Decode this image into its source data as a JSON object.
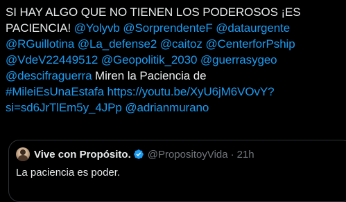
{
  "tweet": {
    "lines": [
      [
        {
          "type": "text",
          "text": "SI HAY ALGO QUE NO TIENEN LOS PODEROSOS ¡ES"
        }
      ],
      [
        {
          "type": "text",
          "text": "PACIENCIA! "
        },
        {
          "type": "mention",
          "text": "@Yolyvb"
        },
        {
          "type": "text",
          "text": " "
        },
        {
          "type": "mention",
          "text": "@SorprendenteF"
        },
        {
          "type": "text",
          "text": " "
        },
        {
          "type": "mention",
          "text": "@dataurgente"
        }
      ],
      [
        {
          "type": "mention",
          "text": "@RGuillotina"
        },
        {
          "type": "text",
          "text": " "
        },
        {
          "type": "mention",
          "text": "@La_defense2"
        },
        {
          "type": "text",
          "text": " "
        },
        {
          "type": "mention",
          "text": "@caitoz"
        },
        {
          "type": "text",
          "text": " "
        },
        {
          "type": "mention",
          "text": "@CenterforPship"
        }
      ],
      [
        {
          "type": "mention",
          "text": "@VdeV22449512"
        },
        {
          "type": "text",
          "text": " "
        },
        {
          "type": "mention",
          "text": "@Geopolitik_2030"
        },
        {
          "type": "text",
          "text": " "
        },
        {
          "type": "mention",
          "text": "@guerrasygeo"
        }
      ],
      [
        {
          "type": "mention",
          "text": "@descifraguerra"
        },
        {
          "type": "text",
          "text": " Miren la Paciencia de"
        }
      ],
      [
        {
          "type": "hashtag",
          "text": "#MileiEsUnaEstafa"
        },
        {
          "type": "text",
          "text": " "
        },
        {
          "type": "link",
          "text": "https://youtu.be/XyU6jM6VOvY?"
        }
      ],
      [
        {
          "type": "link",
          "text": "si=sd6JrTlEm5y_4JPp"
        },
        {
          "type": "text",
          "text": " "
        },
        {
          "type": "mention",
          "text": "@adrianmurano"
        }
      ]
    ]
  },
  "quote": {
    "display_name": "Vive con Propósito.",
    "handle": "@PropositoyVida",
    "separator": "·",
    "time": "21h",
    "body": "La paciencia es poder.",
    "verified_icon": "verified-badge-icon",
    "verified_color": "#1d9bf0"
  },
  "colors": {
    "background": "#000000",
    "text": "#e7e9ea",
    "accent": "#1d9bf0",
    "muted": "#71767b",
    "border": "#2f3336"
  }
}
